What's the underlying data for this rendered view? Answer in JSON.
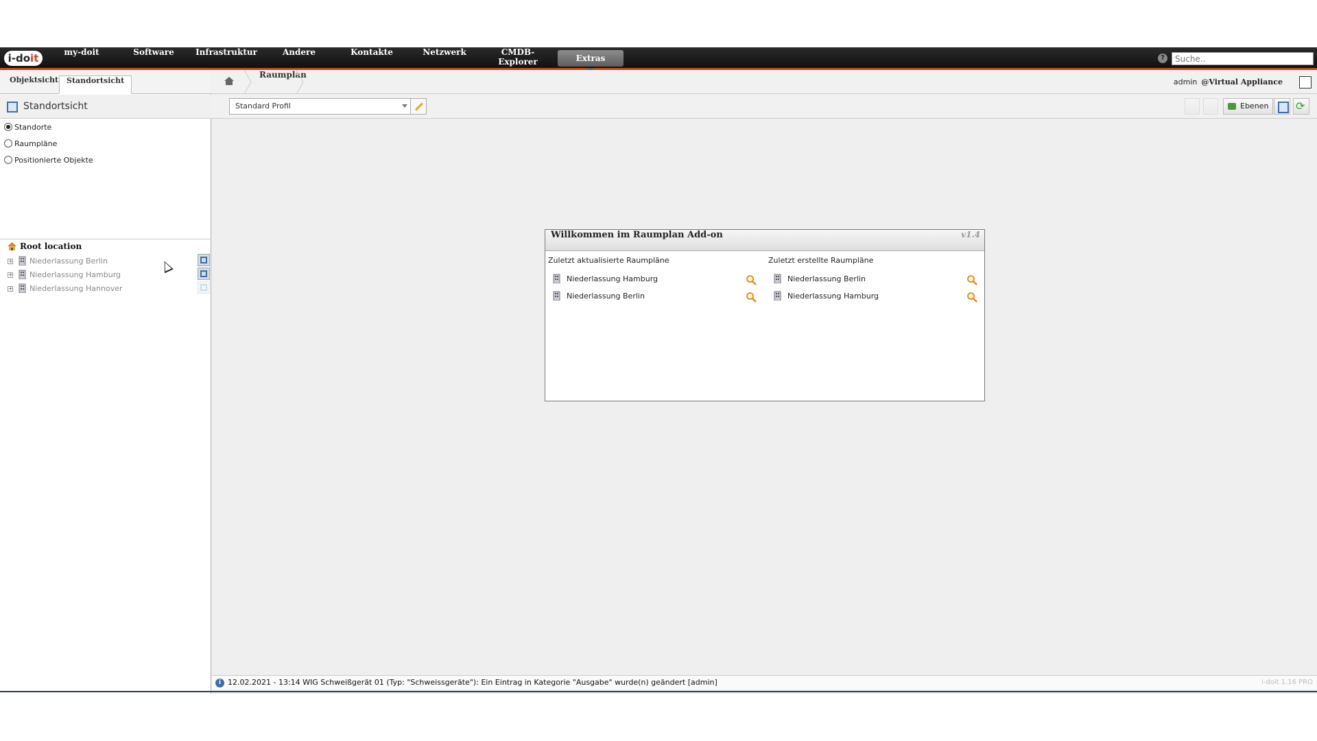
{
  "brand": {
    "logo_text_main": "i-do",
    "logo_text_accent": "it"
  },
  "nav": {
    "items": [
      {
        "label": "my-doit"
      },
      {
        "label": "Software"
      },
      {
        "label": "Infrastruktur"
      },
      {
        "label": "Andere"
      },
      {
        "label": "Kontakte"
      },
      {
        "label": "Netzwerk"
      },
      {
        "label": "CMDB-Explorer"
      },
      {
        "label": "Extras"
      }
    ],
    "active": "Extras",
    "search_placeholder": "Suche.."
  },
  "left": {
    "tabs": [
      {
        "label": "Objektsicht"
      },
      {
        "label": "Standortsicht"
      }
    ],
    "active_tab": "Standortsicht",
    "title": "Standortsicht",
    "radios": [
      {
        "label": "Standorte",
        "checked": true
      },
      {
        "label": "Raumpläne",
        "checked": false
      },
      {
        "label": "Positionierte Objekte",
        "checked": false
      }
    ],
    "tree": {
      "root": "Root location",
      "children": [
        {
          "label": "Niederlassung Berlin"
        },
        {
          "label": "Niederlassung Hamburg"
        },
        {
          "label": "Niederlassung Hannover"
        }
      ]
    }
  },
  "breadcrumb": {
    "current": "Raumplan"
  },
  "user": {
    "name": "admin",
    "tenant": "@Virtual Appliance"
  },
  "toolbar": {
    "profile": "Standard Profil",
    "layers_label": "Ebenen"
  },
  "welcome": {
    "title": "Willkommen im Raumplan Add-on",
    "version": "v1.4",
    "updated_title": "Zuletzt aktualisierte Raumpläne",
    "updated": [
      {
        "label": "Niederlassung Hamburg"
      },
      {
        "label": "Niederlassung Berlin"
      }
    ],
    "created_title": "Zuletzt erstellte Raumpläne",
    "created": [
      {
        "label": "Niederlassung Berlin"
      },
      {
        "label": "Niederlassung Hamburg"
      }
    ]
  },
  "status": {
    "message": "12.02.2021 - 13:14 WIG Schweißgerät 01 (Typ: \"Schweissgeräte\"): Ein Eintrag in Kategorie \"Ausgabe\" wurde(n) geändert [admin]",
    "version": "i-doit 1.16 PRO"
  },
  "colors": {
    "accent": "#c8461d",
    "navbar": "#1a1a1a",
    "link_blue": "#3d6ea8",
    "magnifier": "#e08a1a"
  }
}
